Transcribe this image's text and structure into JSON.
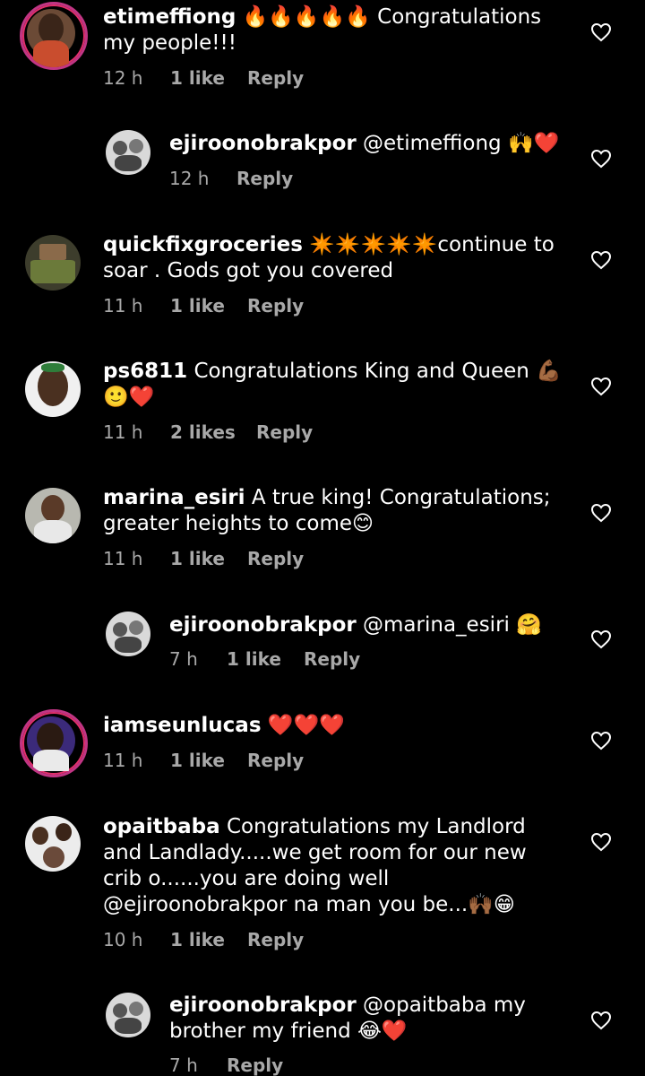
{
  "comments": [
    {
      "user": "etimeffiong",
      "text": "🔥🔥🔥🔥🔥 Congratulations my people!!!",
      "time": "12 h",
      "likes": "1 like",
      "reply": "Reply"
    },
    {
      "user": "ejiroonobrakpor",
      "text": "@etimeffiong 🙌❤️",
      "time": "12 h",
      "likes": "",
      "reply": "Reply"
    },
    {
      "user": "quickfixgroceries",
      "text": "✴️✴️✴️✴️✴️continue to soar . Gods got you covered",
      "time": "11 h",
      "likes": "1 like",
      "reply": "Reply"
    },
    {
      "user": "ps6811",
      "text": "Congratulations King and Queen 💪🏾🙂❤️",
      "time": "11 h",
      "likes": "2 likes",
      "reply": "Reply"
    },
    {
      "user": "marina_esiri",
      "text": "A true king! Congratulations; greater heights to come😊",
      "time": "11 h",
      "likes": "1 like",
      "reply": "Reply"
    },
    {
      "user": "ejiroonobrakpor",
      "text": "@marina_esiri 🤗",
      "time": "7 h",
      "likes": "1 like",
      "reply": "Reply"
    },
    {
      "user": "iamseunlucas",
      "text": "❤️❤️❤️",
      "time": "11 h",
      "likes": "1 like",
      "reply": "Reply"
    },
    {
      "user": "opaitbaba",
      "text": "Congratulations my Landlord and Landlady.....we get room for our new crib o......you are doing well @ejiroonobrakpor na man you be...🙌🏾😁",
      "time": "10 h",
      "likes": "1 like",
      "reply": "Reply"
    },
    {
      "user": "ejiroonobrakpor",
      "text": "@opaitbaba my brother my friend 😂❤️",
      "time": "7 h",
      "likes": "",
      "reply": "Reply"
    }
  ],
  "colors": {
    "background": "#000000",
    "meta": "#a8a8a8",
    "ring": "#c13584"
  },
  "icons": {
    "like": "heart-outline-icon"
  }
}
